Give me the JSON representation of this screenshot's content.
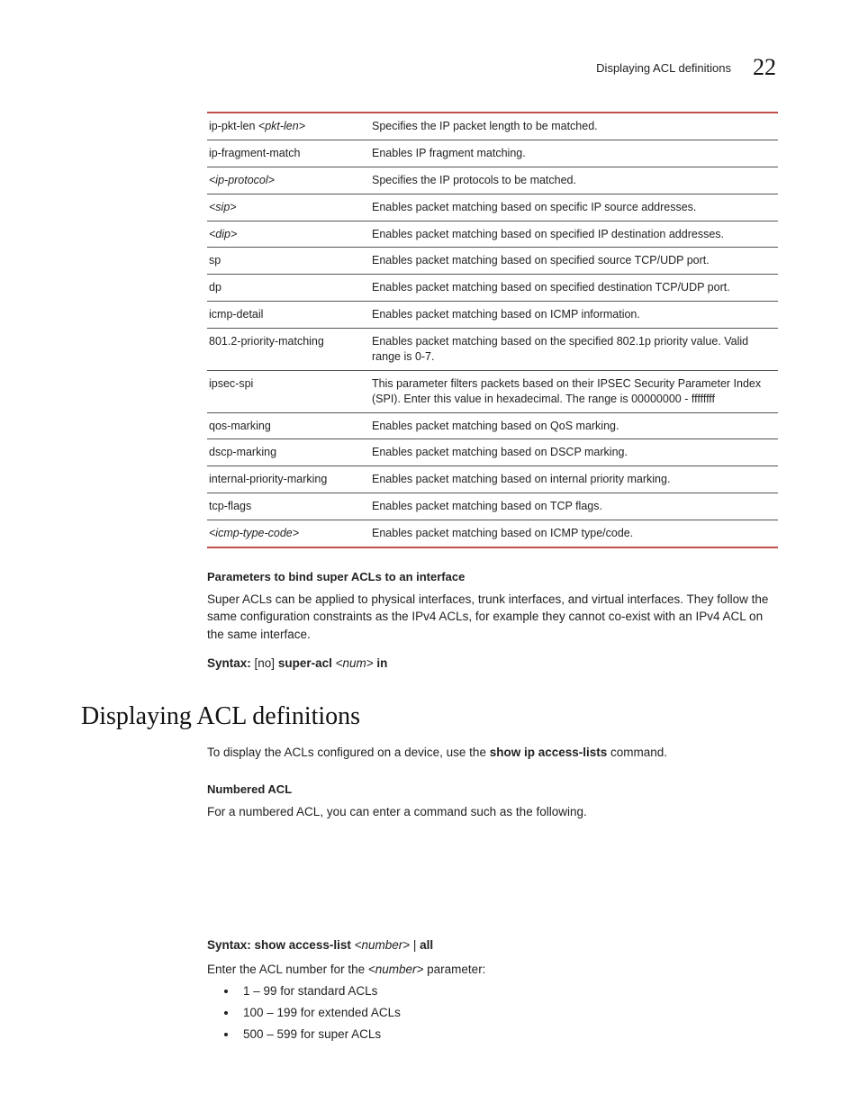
{
  "header": {
    "title": "Displaying ACL definitions",
    "chapter": "22"
  },
  "table": {
    "rows": [
      {
        "param_prefix": "ip-pkt-len ",
        "param_italic": "<pkt-len>",
        "desc": "Specifies the IP packet length to be matched."
      },
      {
        "param_prefix": "ip-fragment-match",
        "param_italic": "",
        "desc": "Enables IP fragment matching."
      },
      {
        "param_prefix": "",
        "param_italic": "<ip-protocol>",
        "desc": "Specifies the IP protocols to be matched."
      },
      {
        "param_prefix": "",
        "param_italic": "<sip>",
        "desc": "Enables packet matching based on specific IP source addresses."
      },
      {
        "param_prefix": "",
        "param_italic": "<dip>",
        "desc": "Enables packet matching based on specified IP destination addresses."
      },
      {
        "param_prefix": "sp",
        "param_italic": "",
        "desc": "Enables packet matching based on specified source TCP/UDP port."
      },
      {
        "param_prefix": "dp",
        "param_italic": "",
        "desc": "Enables packet matching based on specified destination TCP/UDP port."
      },
      {
        "param_prefix": "icmp-detail",
        "param_italic": "",
        "desc": "Enables packet matching based on ICMP information."
      },
      {
        "param_prefix": "801.2-priority-matching",
        "param_italic": "",
        "desc": "Enables packet matching based on the specified 802.1p priority value. Valid range is 0-7."
      },
      {
        "param_prefix": "ipsec-spi",
        "param_italic": "",
        "desc": "This parameter filters packets based on their IPSEC Security Parameter Index (SPI). Enter this value in hexadecimal. The range is 00000000 - ffffffff"
      },
      {
        "param_prefix": "qos-marking",
        "param_italic": "",
        "desc": "Enables packet matching based on QoS marking."
      },
      {
        "param_prefix": "dscp-marking",
        "param_italic": "",
        "desc": "Enables packet matching based on DSCP marking."
      },
      {
        "param_prefix": "internal-priority-marking",
        "param_italic": "",
        "desc": "Enables packet matching based on internal priority marking."
      },
      {
        "param_prefix": "tcp-flags",
        "param_italic": "",
        "desc": "Enables packet matching based on TCP flags."
      },
      {
        "param_prefix": "",
        "param_italic": "<icmp-type-code>",
        "desc": "Enables packet matching based on ICMP type/code."
      }
    ]
  },
  "sec1": {
    "heading": "Parameters to bind super ACLs to an interface",
    "para": "Super ACLs can be applied to physical interfaces, trunk interfaces, and virtual interfaces. They follow the same configuration constraints as the IPv4 ACLs, for example they cannot co-exist with an IPv4 ACL on the same interface.",
    "syntax_label": "Syntax:",
    "syntax_body1": " [no] ",
    "syntax_body2": "super-acl ",
    "syntax_body3": "<num>",
    "syntax_body4": " in"
  },
  "h2": "Displaying ACL definitions",
  "sec2": {
    "intro_a": "To display the ACLs configured on a device, use the ",
    "intro_b": "show ip access-lists",
    "intro_c": " command.",
    "numbered_heading": "Numbered ACL",
    "numbered_para": "For a numbered ACL, you can enter a command such as the following.",
    "syntax_label": "Syntax:",
    "syntax_b1": " show access-list ",
    "syntax_b2": "<number>",
    "syntax_b3": " | ",
    "syntax_b4": "all",
    "enter_a": "Enter the ACL number for the ",
    "enter_b": "<number>",
    "enter_c": " parameter:",
    "bullets": [
      "1 – 99 for standard ACLs",
      "100 – 199 for extended ACLs",
      "500 – 599 for super ACLs"
    ]
  }
}
